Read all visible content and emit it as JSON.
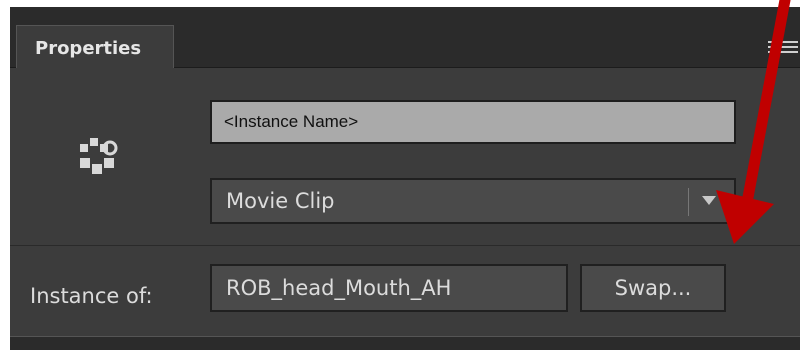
{
  "panel": {
    "tab_label": "Properties",
    "menu_icon": "panel-menu-icon"
  },
  "symbol": {
    "icon": "movie-clip-gear-icon",
    "instance_name_placeholder": "<Instance Name>",
    "type_value": "Movie Clip"
  },
  "instance_of": {
    "label": "Instance of:",
    "value": "ROB_head_Mouth_AH",
    "swap_label": "Swap..."
  },
  "annotation": {
    "arrow_color": "#c00000"
  }
}
